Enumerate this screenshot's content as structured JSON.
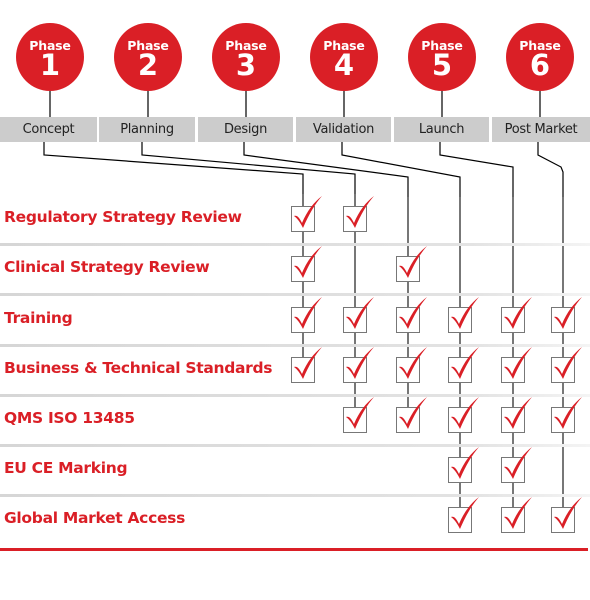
{
  "diagram": {
    "phases": [
      {
        "word": "Phase",
        "number": "1",
        "label": "Concept"
      },
      {
        "word": "Phase",
        "number": "2",
        "label": "Planning"
      },
      {
        "word": "Phase",
        "number": "3",
        "label": "Design"
      },
      {
        "word": "Phase",
        "number": "4",
        "label": "Validation"
      },
      {
        "word": "Phase",
        "number": "5",
        "label": "Launch"
      },
      {
        "word": "Phase",
        "number": "6",
        "label": "Post Market"
      }
    ],
    "services": [
      {
        "label": "Regulatory Strategy Review",
        "phases": [
          1,
          2
        ]
      },
      {
        "label": "Clinical Strategy Review",
        "phases": [
          1,
          3
        ]
      },
      {
        "label": "Training",
        "phases": [
          1,
          2,
          3,
          4,
          5,
          6
        ]
      },
      {
        "label": "Business & Technical Standards",
        "phases": [
          1,
          2,
          3,
          4,
          5,
          6
        ]
      },
      {
        "label": "QMS ISO 13485",
        "phases": [
          2,
          3,
          4,
          5,
          6
        ]
      },
      {
        "label": "EU CE Marking",
        "phases": [
          4,
          5
        ]
      },
      {
        "label": "Global Market Access",
        "phases": [
          4,
          5,
          6
        ]
      }
    ],
    "icons": {
      "check": "red-checkmark-in-box-icon"
    },
    "colors": {
      "accent": "#da1f26",
      "label_bar": "#cccccc",
      "connector": "#000000",
      "column_line": "#555555"
    }
  }
}
